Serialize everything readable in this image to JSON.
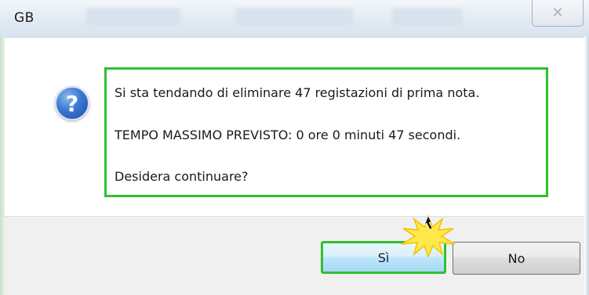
{
  "window": {
    "title": "GB",
    "close_glyph": "✕"
  },
  "dialog": {
    "icon": "question-icon",
    "icon_glyph": "?",
    "messages": [
      "Si sta tendando di eliminare 47 registazioni di prima nota.",
      "TEMPO MASSIMO PREVISTO: 0 ore 0 minuti 47 secondi.",
      "Desidera continuare?"
    ]
  },
  "buttons": {
    "yes_label": "Sì",
    "no_label": "No"
  },
  "colors": {
    "highlight": "#2fc02f",
    "burst": "#ffe84a"
  }
}
